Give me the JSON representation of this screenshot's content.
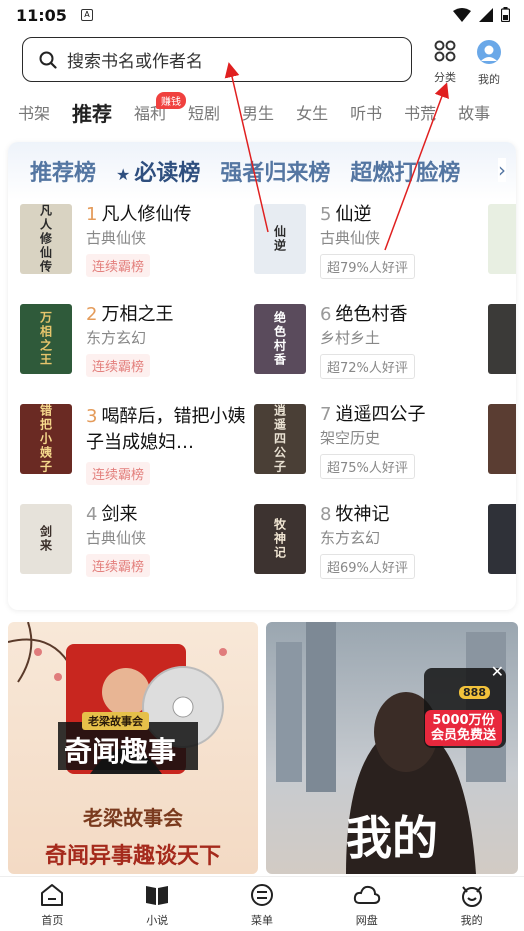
{
  "status": {
    "time": "11:05",
    "a_icon": "A"
  },
  "search": {
    "placeholder": "搜索书名或作者名"
  },
  "top_actions": {
    "category_label": "分类",
    "profile_label": "我的"
  },
  "tabs": [
    {
      "label": "书架"
    },
    {
      "label": "推荐"
    },
    {
      "label": "福利"
    },
    {
      "label": "短剧"
    },
    {
      "label": "男生"
    },
    {
      "label": "女生"
    },
    {
      "label": "听书"
    },
    {
      "label": "书荒"
    },
    {
      "label": "故事"
    }
  ],
  "tab_badge": "赚钱",
  "rank_tabs": [
    {
      "label": "推荐榜"
    },
    {
      "label": "必读榜"
    },
    {
      "label": "强者归来榜"
    },
    {
      "label": "超燃打脸榜"
    }
  ],
  "books": [
    {
      "num": "1",
      "title": "凡人修仙传",
      "genre": "古典仙侠",
      "tag": "连续霸榜",
      "cover_text": "凡人修仙传",
      "cover_color": "#d9d3c2"
    },
    {
      "num": "2",
      "title": "万相之王",
      "genre": "东方玄幻",
      "tag": "连续霸榜",
      "cover_text": "万相之王",
      "cover_color": "#2f5a3a"
    },
    {
      "num": "3",
      "title": "喝醉后，错把小姨子当成媳妇…",
      "genre": "",
      "tag": "连续霸榜",
      "cover_text": "错把小姨子",
      "cover_color": "#6a2a23"
    },
    {
      "num": "4",
      "title": "剑来",
      "genre": "古典仙侠",
      "tag": "连续霸榜",
      "cover_text": "剑来",
      "cover_color": "#e6e2da"
    },
    {
      "num": "5",
      "title": "仙逆",
      "genre": "古典仙侠",
      "tag": "超79%人好评",
      "cover_text": "仙逆",
      "cover_color": "#e7ecf2"
    },
    {
      "num": "6",
      "title": "绝色村香",
      "genre": "乡村乡土",
      "tag": "超72%人好评",
      "cover_text": "绝色村香",
      "cover_color": "#5a4b5c"
    },
    {
      "num": "7",
      "title": "逍遥四公子",
      "genre": "架空历史",
      "tag": "超75%人好评",
      "cover_text": "逍遥四公子",
      "cover_color": "#4a3f36"
    },
    {
      "num": "8",
      "title": "牧神记",
      "genre": "东方玄幻",
      "tag": "超69%人好评",
      "cover_text": "牧神记",
      "cover_color": "#3d3330"
    }
  ],
  "banners": {
    "left_badge": "老梁故事会",
    "left_title": "奇闻趣事",
    "left_sub1": "老梁故事会",
    "left_sub2": "奇闻异事趣谈天下",
    "right_big": "我的",
    "right_ad_num": "888",
    "right_ad_line1": "5000万份",
    "right_ad_line2": "会员免费送"
  },
  "bottom_nav": [
    {
      "label": "首页"
    },
    {
      "label": "小说"
    },
    {
      "label": "菜单"
    },
    {
      "label": "网盘"
    },
    {
      "label": "我的"
    }
  ]
}
